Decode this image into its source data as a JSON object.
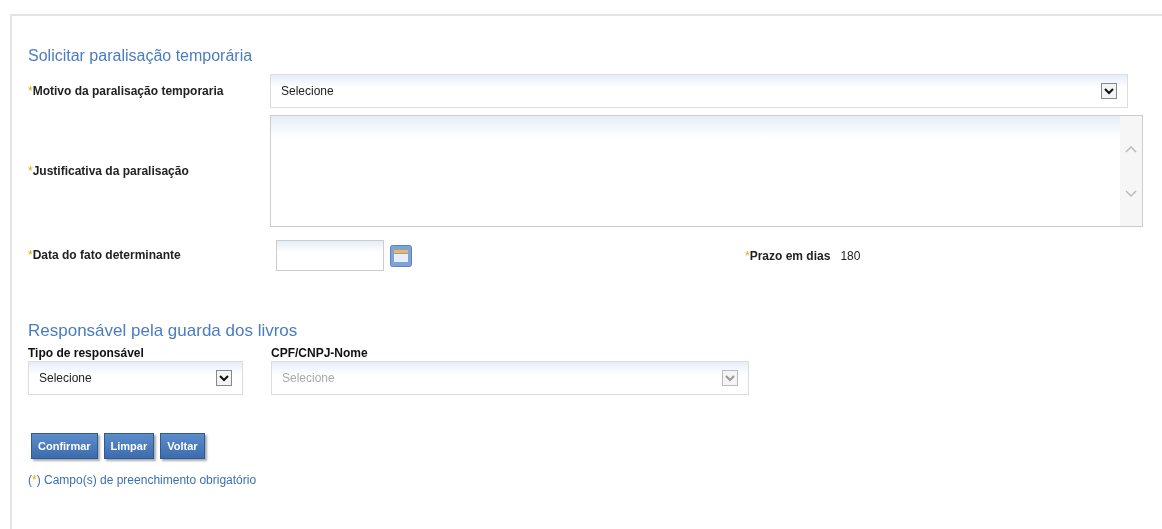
{
  "form": {
    "title": "Solicitar paralisação temporária",
    "motivo": {
      "mark": "*",
      "label": "Motivo da paralisação temporaria",
      "value": "Selecione"
    },
    "justificativa": {
      "mark": "*",
      "label": "Justificativa da paralisação"
    },
    "data": {
      "mark": "*",
      "label": "Data do fato determinante"
    },
    "prazo": {
      "mark": "*",
      "label": "Prazo em dias",
      "value": "180"
    }
  },
  "responsavel": {
    "title": "Responsável pela guarda dos livros",
    "selects": [
      {
        "label": "Tipo de responsável",
        "value": "Selecione",
        "disabled": false
      },
      {
        "label": "CPF/CNPJ-Nome",
        "value": "Selecione",
        "disabled": true
      }
    ]
  },
  "buttons": [
    "Confirmar",
    "Limpar",
    "Voltar"
  ],
  "note": {
    "open": "(",
    "mark": "*",
    "rest": ") Campo(s) de preenchimento obrigatório"
  }
}
